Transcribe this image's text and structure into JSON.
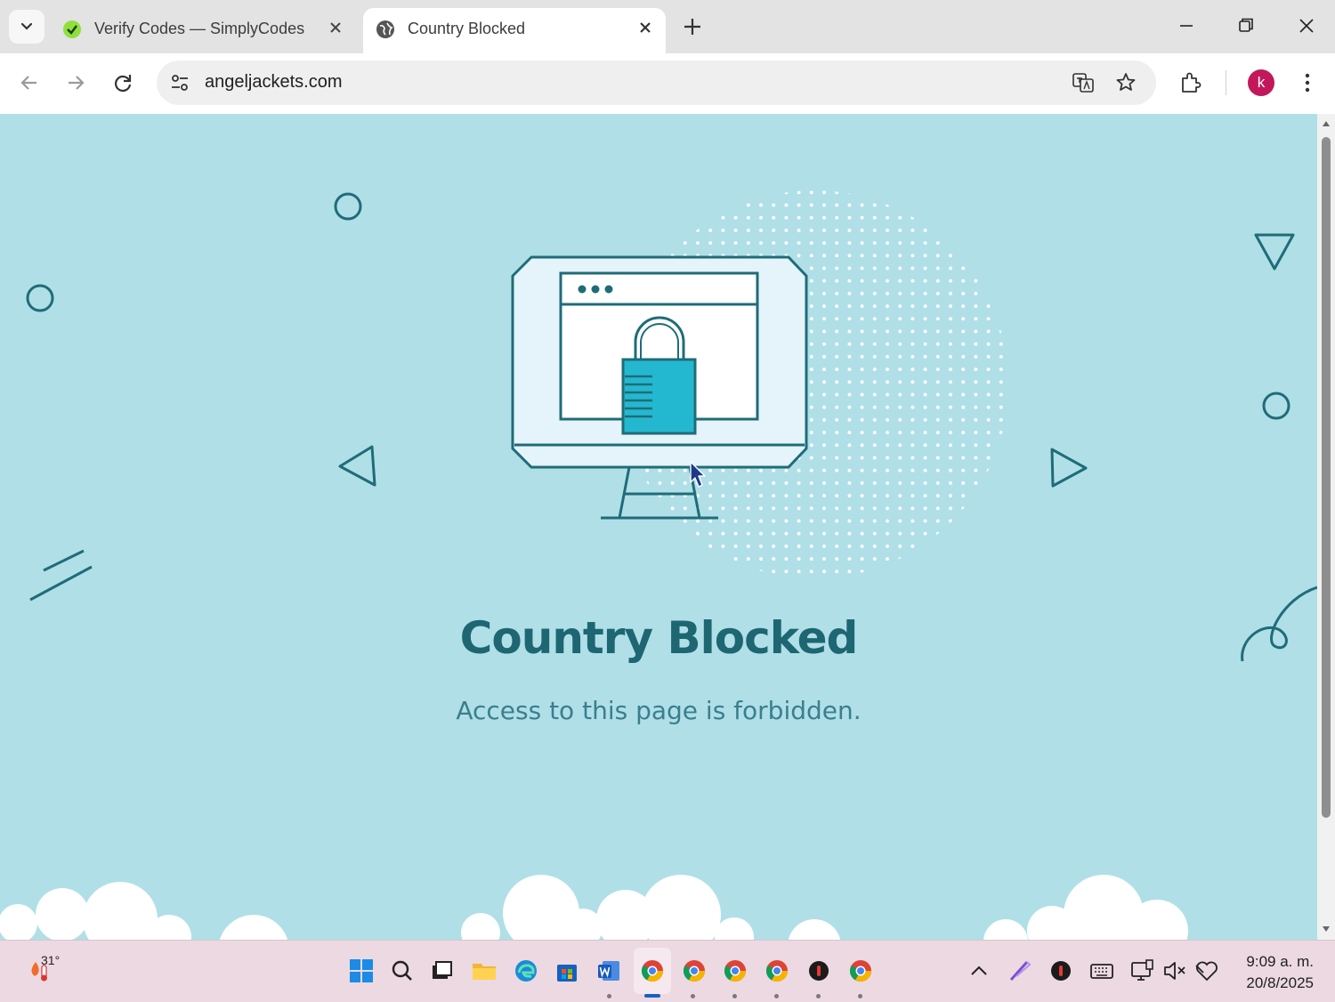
{
  "browser": {
    "tabs": [
      {
        "title": "Verify Codes — SimplyCodes",
        "active": false
      },
      {
        "title": "Country Blocked",
        "active": true
      }
    ],
    "url": "angeljackets.com",
    "profile_initial": "k"
  },
  "page": {
    "heading": "Country Blocked",
    "message": "Access to this page is forbidden."
  },
  "taskbar": {
    "weather_temp": "31°",
    "time": "9:09 a. m.",
    "date": "20/8/2025"
  },
  "colors": {
    "page_bg": "#b0dfe8",
    "accent": "#1d6672",
    "lock": "#24b8d0",
    "profile": "#c2185b"
  }
}
